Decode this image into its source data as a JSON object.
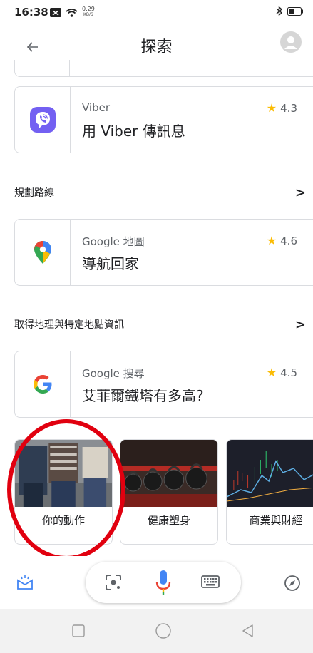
{
  "status_bar": {
    "time": "16:38",
    "speed_value": "0.29",
    "speed_unit": "KB/S"
  },
  "header": {
    "title": "探索"
  },
  "cards": [
    {
      "app": "Viber",
      "action": "用 Viber 傳訊息",
      "rating": "4.3"
    },
    {
      "app": "Google 地圖",
      "action": "導航回家",
      "rating": "4.6"
    },
    {
      "app": "Google 搜尋",
      "action": "艾菲爾鐵塔有多高?",
      "rating": "4.5"
    }
  ],
  "sections": [
    {
      "title": "規劃路線"
    },
    {
      "title": "取得地理與特定地點資訊"
    }
  ],
  "topics": [
    {
      "label": "你的動作"
    },
    {
      "label": "健康塑身"
    },
    {
      "label": "商業與財經"
    }
  ],
  "colors": {
    "viber": "#7360f2",
    "star": "#fbbc04",
    "annotation": "#e1000f",
    "google_blue": "#4285f4",
    "google_red": "#ea4335",
    "google_yellow": "#fbbc05",
    "google_green": "#34a853"
  }
}
